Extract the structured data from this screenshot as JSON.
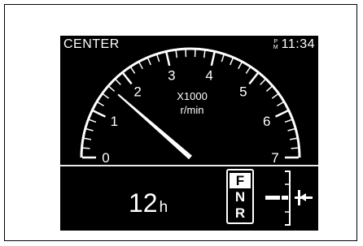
{
  "header": {
    "mode": "CENTER",
    "ampm_top": "P",
    "ampm_bottom": "M",
    "time": "11:34"
  },
  "tachometer": {
    "unit_multiplier": "X1000",
    "unit": "r/min",
    "scale_labels": [
      "0",
      "1",
      "2",
      "3",
      "4",
      "5",
      "6",
      "7"
    ],
    "scale_max": 7,
    "needle_value": 1.6,
    "tick_color": "#ffffff",
    "needle_color": "#ffffff"
  },
  "hour_meter": {
    "value": "12",
    "unit": "h"
  },
  "gear_selector": {
    "positions": [
      "F",
      "N",
      "R"
    ],
    "selected": "F"
  },
  "indicator": {
    "icon": "direction-lever-indicator-icon"
  },
  "colors": {
    "background": "#000000",
    "foreground": "#ffffff",
    "divider": "#e8e8e8"
  }
}
